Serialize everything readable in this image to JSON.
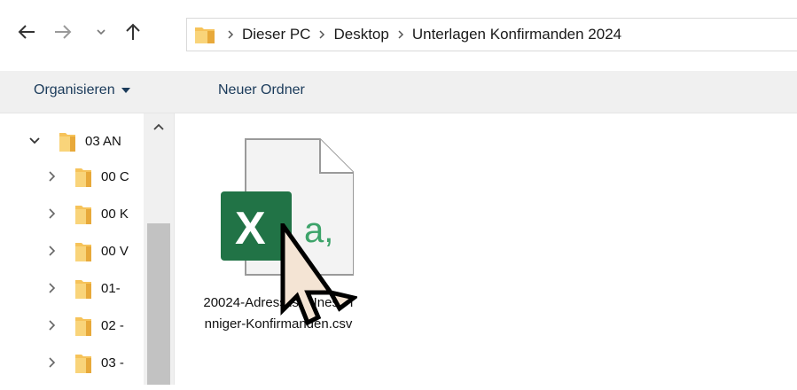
{
  "nav": {
    "back_icon": "arrow-left-icon",
    "forward_icon": "arrow-right-icon",
    "recent_icon": "chevron-down-icon",
    "up_icon": "arrow-up-icon"
  },
  "address": {
    "breadcrumbs": [
      "Dieser PC",
      "Desktop",
      "Unterlagen Konfirmanden 2024"
    ]
  },
  "toolbar": {
    "organize_label": "Organisieren",
    "new_folder_label": "Neuer Ordner"
  },
  "tree": {
    "items": [
      {
        "label": "03 AN",
        "expanded": true
      },
      {
        "label": "00 C",
        "expanded": false
      },
      {
        "label": "00 K",
        "expanded": false
      },
      {
        "label": "00 V",
        "expanded": false
      },
      {
        "label": "01-",
        "expanded": false
      },
      {
        "label": "02 -",
        "expanded": false
      },
      {
        "label": "03 -",
        "expanded": false
      }
    ]
  },
  "files": [
    {
      "name": "20024-Adressliste Inese Inniger-Konfirmanden.csv",
      "icon": "excel-csv-icon"
    }
  ],
  "colors": {
    "folder": "#f6c35a",
    "excel_green": "#217346",
    "toolbar_bg": "#f0f0f0"
  }
}
